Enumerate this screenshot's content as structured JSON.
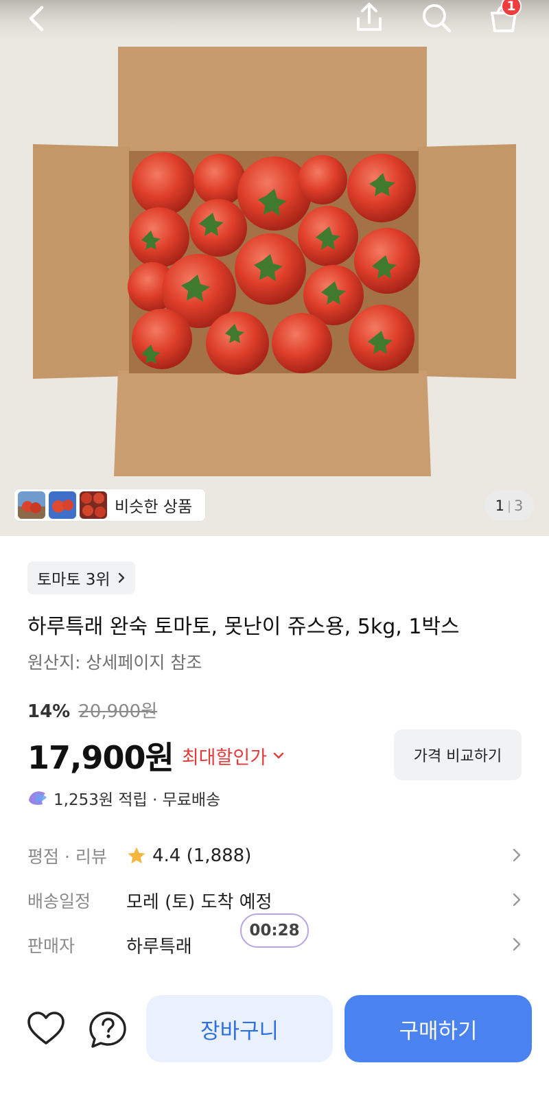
{
  "header": {
    "back_icon": "chevron-left-icon",
    "share_icon": "share-icon",
    "search_icon": "search-icon",
    "cart_icon": "shopping-bag-icon",
    "cart_count": "1"
  },
  "gallery": {
    "similar_label": "비슷한 상품",
    "current_page": "1",
    "total_pages": "3"
  },
  "product": {
    "rank_label": "토마토 3위",
    "title": "하루특래 완숙 토마토, 못난이 쥬스용, 5kg, 1박스",
    "origin": "원산지: 상세페이지 참조",
    "discount_rate": "14%",
    "original_price": "20,900원",
    "price": "17,900원",
    "max_discount_label": "최대할인가",
    "compare_label": "가격 비교하기",
    "points_text": "1,253원 적립 · 무료배송"
  },
  "info": {
    "review_label": "평점 · 리뷰",
    "rating": "4.4 (1,888)",
    "shipping_label": "배송일정",
    "shipping_value": "모레 (토) 도착 예정",
    "seller_label": "판매자",
    "seller_value": "하루특래",
    "timer": "00:28"
  },
  "actions": {
    "cart_label": "장바구니",
    "buy_label": "구매하기"
  },
  "colors": {
    "accent_blue": "#4a83ef",
    "discount_red": "#e23b3b",
    "badge_red": "#ef3c3c"
  }
}
